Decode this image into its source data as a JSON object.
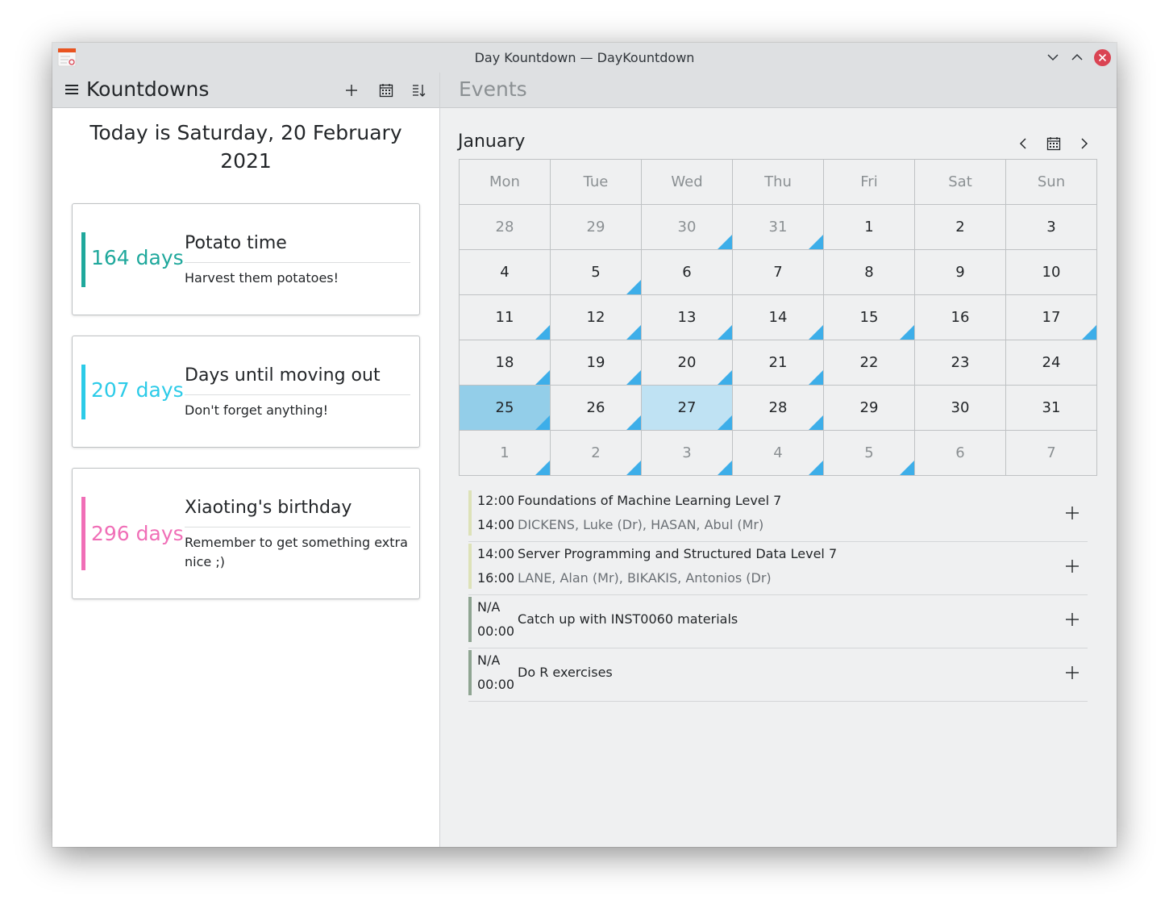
{
  "window": {
    "title": "Day Kountdown — DayKountdown"
  },
  "left": {
    "title": "Kountdowns",
    "today": "Today is Saturday, 20 February 2021",
    "kountdowns": [
      {
        "days": "164 days",
        "name": "Potato time",
        "description": "Harvest them potatoes!",
        "color": "#1fa89c"
      },
      {
        "days": "207 days",
        "name": "Days until moving out",
        "description": "Don't forget anything!",
        "color": "#2ccbe8"
      },
      {
        "days": "296 days",
        "name": "Xiaoting's birthday",
        "description": "Remember to get something extra nice ;)",
        "color": "#f06fb7"
      }
    ]
  },
  "right": {
    "title": "Events",
    "month": "January",
    "weekdays": [
      "Mon",
      "Tue",
      "Wed",
      "Thu",
      "Fri",
      "Sat",
      "Sun"
    ],
    "weeks": [
      [
        {
          "d": "28",
          "o": true
        },
        {
          "d": "29",
          "o": true
        },
        {
          "d": "30",
          "o": true,
          "e": true
        },
        {
          "d": "31",
          "o": true,
          "e": true
        },
        {
          "d": "1"
        },
        {
          "d": "2"
        },
        {
          "d": "3"
        }
      ],
      [
        {
          "d": "4"
        },
        {
          "d": "5",
          "e": true
        },
        {
          "d": "6"
        },
        {
          "d": "7"
        },
        {
          "d": "8"
        },
        {
          "d": "9"
        },
        {
          "d": "10"
        }
      ],
      [
        {
          "d": "11",
          "e": true
        },
        {
          "d": "12",
          "e": true
        },
        {
          "d": "13",
          "e": true
        },
        {
          "d": "14",
          "e": true
        },
        {
          "d": "15",
          "e": true
        },
        {
          "d": "16"
        },
        {
          "d": "17",
          "e": true
        }
      ],
      [
        {
          "d": "18",
          "e": true
        },
        {
          "d": "19",
          "e": true
        },
        {
          "d": "20",
          "e": true
        },
        {
          "d": "21",
          "e": true
        },
        {
          "d": "22"
        },
        {
          "d": "23"
        },
        {
          "d": "24"
        }
      ],
      [
        {
          "d": "25",
          "e": true,
          "s": "sel"
        },
        {
          "d": "26",
          "e": true
        },
        {
          "d": "27",
          "e": true,
          "s": "today"
        },
        {
          "d": "28",
          "e": true
        },
        {
          "d": "29"
        },
        {
          "d": "30"
        },
        {
          "d": "31"
        }
      ],
      [
        {
          "d": "1",
          "o": true,
          "e": true
        },
        {
          "d": "2",
          "o": true,
          "e": true
        },
        {
          "d": "3",
          "o": true,
          "e": true
        },
        {
          "d": "4",
          "o": true,
          "e": true
        },
        {
          "d": "5",
          "o": true,
          "e": true
        },
        {
          "d": "6",
          "o": true
        },
        {
          "d": "7",
          "o": true
        }
      ]
    ],
    "events": [
      {
        "start": "12:00",
        "end": "14:00",
        "title": "Foundations of Machine Learning Level 7",
        "subtitle": "DICKENS, Luke (Dr), HASAN, Abul (Mr)",
        "color": "#dde2b8"
      },
      {
        "start": "14:00",
        "end": "16:00",
        "title": "Server Programming and Structured Data Level 7",
        "subtitle": "LANE, Alan (Mr), BIKAKIS, Antonios (Dr)",
        "color": "#dde2b8"
      },
      {
        "start": "N/A",
        "end": "00:00",
        "title": "Catch up with INST0060 materials",
        "subtitle": "",
        "color": "#8fa592"
      },
      {
        "start": "N/A",
        "end": "00:00",
        "title": "Do R exercises",
        "subtitle": "",
        "color": "#8fa592"
      }
    ]
  },
  "colors": {
    "accent": "#3daee9",
    "selected_day": "#93cee9",
    "today_day": "#bfe2f3",
    "close": "#da4453"
  }
}
